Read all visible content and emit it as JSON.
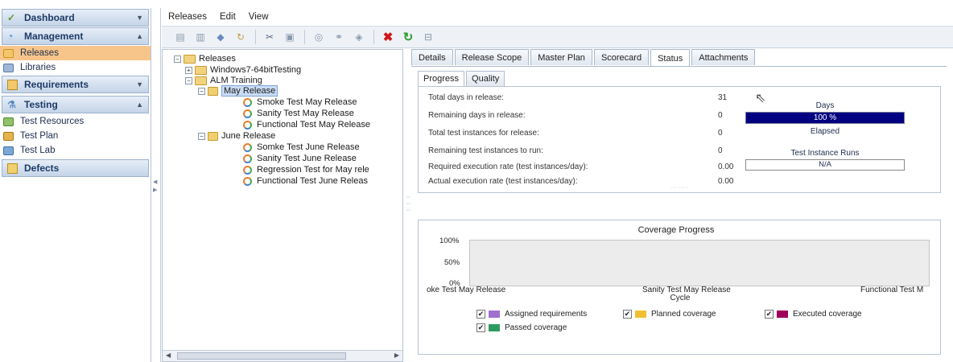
{
  "sidebar": {
    "groups": {
      "dashboard": "Dashboard",
      "management": "Management",
      "requirements": "Requirements",
      "testing": "Testing",
      "defects": "Defects"
    },
    "items": {
      "releases": "Releases",
      "libraries": "Libraries",
      "test_resources": "Test Resources",
      "test_plan": "Test Plan",
      "test_lab": "Test Lab"
    }
  },
  "menubar": [
    "Releases",
    "Edit",
    "View"
  ],
  "tree": {
    "root": "Releases",
    "folders": [
      "Windows7-64bitTesting",
      "ALM Training"
    ],
    "may_release": {
      "label": "May Release",
      "cycles": [
        "Smoke Test May Release",
        "Sanity Test May Release",
        "Functional Test May Release"
      ]
    },
    "june_release": {
      "label": "June Release",
      "cycles": [
        "Somke Test June Release",
        "Sanity Test June Release",
        "Regression Test for May rele",
        "Functional Test June Releas"
      ]
    }
  },
  "tabs": [
    "Details",
    "Release Scope",
    "Master Plan",
    "Scorecard",
    "Status",
    "Attachments"
  ],
  "subtabs": [
    "Progress",
    "Quality"
  ],
  "status": {
    "rows": [
      {
        "label": "Total days in release:",
        "value": "31"
      },
      {
        "label": "Remaining days in release:",
        "value": "0"
      },
      {
        "label": "Total test instances for release:",
        "value": "0"
      },
      {
        "label": "Remaining test instances to run:",
        "value": "0"
      },
      {
        "label": "Required execution rate (test instances/day):",
        "value": "0.00"
      },
      {
        "label": "Actual execution rate (test instances/day):",
        "value": "0.00"
      }
    ],
    "days_caption": "Days",
    "days_percent_label": "100 %",
    "days_fraction": 1.0,
    "elapsed_label": "Elapsed",
    "test_instance_runs_caption": "Test Instance Runs",
    "test_instance_runs_value": "N/A"
  },
  "coverage": {
    "title": "Coverage Progress",
    "yticks": [
      "100%",
      "50%",
      "0%"
    ],
    "xticks": [
      "oke Test May Release",
      "Sanity Test May Release",
      "Functional Test M"
    ],
    "xlabel": "Cycle",
    "legend": [
      {
        "label": "Assigned requirements",
        "color": "#a070d0"
      },
      {
        "label": "Planned coverage",
        "color": "#f0c030"
      },
      {
        "label": "Executed coverage",
        "color": "#a0005a"
      },
      {
        "label": "Passed coverage",
        "color": "#2e9a60"
      }
    ]
  },
  "colors": {
    "selected_nav": "#f7c58a",
    "progress_fill": "#000080"
  }
}
